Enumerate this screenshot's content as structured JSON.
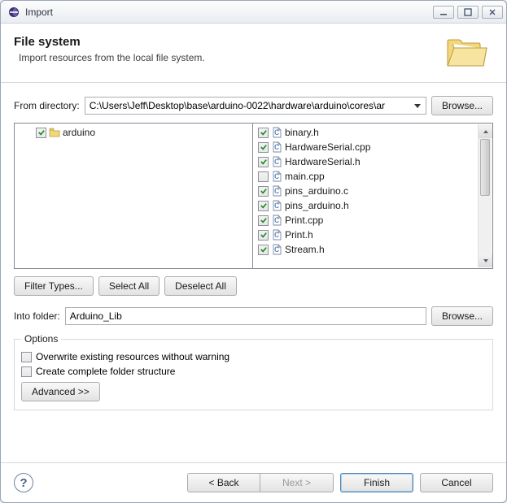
{
  "window": {
    "title": "Import"
  },
  "header": {
    "title": "File system",
    "desc": "Import resources from the local file system."
  },
  "fromDir": {
    "label": "From directory:",
    "value": "C:\\Users\\Jeff\\Desktop\\base\\arduino-0022\\hardware\\arduino\\cores\\ar"
  },
  "browse": "Browse...",
  "tree": {
    "root": "arduino"
  },
  "files": [
    {
      "name": "binary.h",
      "checked": true
    },
    {
      "name": "HardwareSerial.cpp",
      "checked": true
    },
    {
      "name": "HardwareSerial.h",
      "checked": true
    },
    {
      "name": "main.cpp",
      "checked": false
    },
    {
      "name": "pins_arduino.c",
      "checked": true
    },
    {
      "name": "pins_arduino.h",
      "checked": true
    },
    {
      "name": "Print.cpp",
      "checked": true
    },
    {
      "name": "Print.h",
      "checked": true
    },
    {
      "name": "Stream.h",
      "checked": true
    }
  ],
  "actions": {
    "filter": "Filter Types...",
    "selectAll": "Select All",
    "deselectAll": "Deselect All"
  },
  "intoFolder": {
    "label": "Into folder:",
    "value": "Arduino_Lib"
  },
  "options": {
    "legend": "Options",
    "overwrite": "Overwrite existing resources without warning",
    "complete": "Create complete folder structure",
    "advanced": "Advanced >>"
  },
  "footer": {
    "back": "< Back",
    "next": "Next >",
    "finish": "Finish",
    "cancel": "Cancel"
  }
}
